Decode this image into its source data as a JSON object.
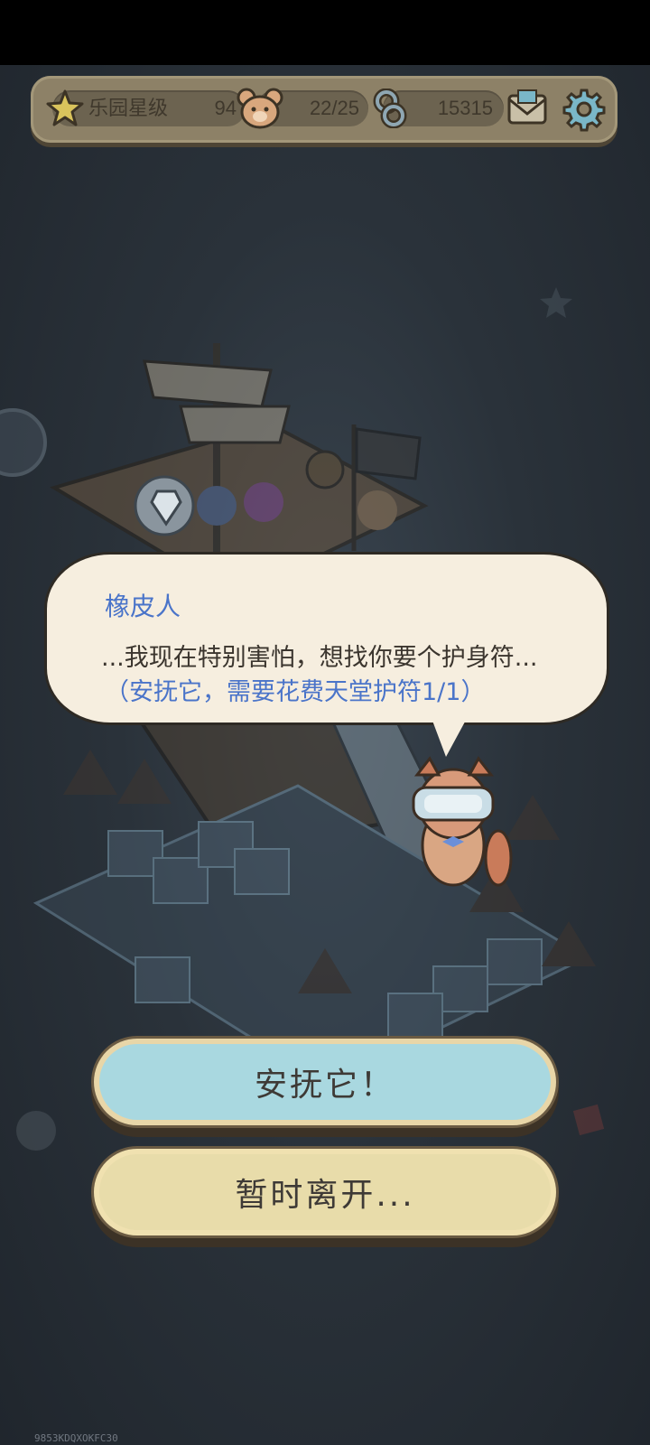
{
  "topbar": {
    "park_rating_label": "乐园星级",
    "park_rating_value": "94",
    "residents": "22/25",
    "currency": "15315"
  },
  "icons": [
    "star-icon",
    "bear-icon",
    "link-icon",
    "mail-icon",
    "gear-icon",
    "crystal-icon"
  ],
  "dialog": {
    "speaker": "橡皮人",
    "line": "...我现在特别害怕，想找你要个护身符...",
    "hint": "（安抚它，需要花费天堂护符1/1）"
  },
  "buttons": {
    "soothe": "安抚它！",
    "leave": "暂时离开..."
  },
  "watermark": "9853KDQXOKFC30",
  "colors": {
    "accent_blue": "#4a74c9",
    "soothe_button": "#a9d8e0",
    "leave_button": "#e8dcaa",
    "bubble": "#f6eedf"
  }
}
